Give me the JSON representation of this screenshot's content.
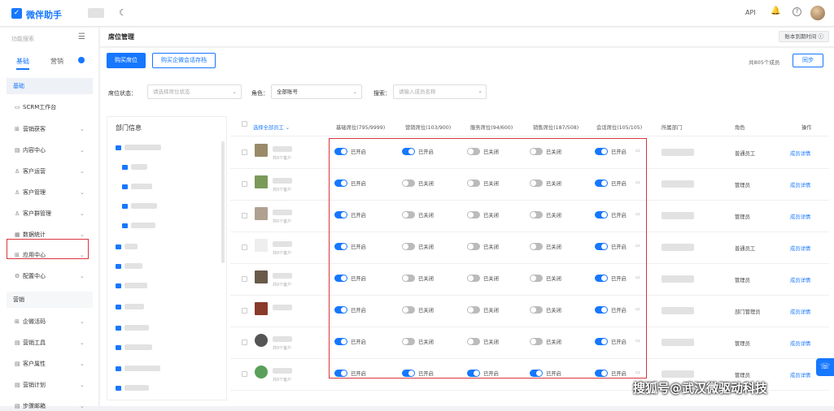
{
  "topbar": {
    "app_name": "微伴助手",
    "logo_glyph": "✓",
    "api_label": "API",
    "bell_icon": "🔔",
    "help_label": "?"
  },
  "sidebar": {
    "search_placeholder": "功能搜索",
    "tab_basic": "基础",
    "tab_marketing": "营销",
    "section_basic": "基础",
    "section_marketing": "营销",
    "items": [
      {
        "icon": "▭",
        "label": "SCRM工作台",
        "chev": false
      },
      {
        "icon": "⊞",
        "label": "营销获客",
        "chev": true
      },
      {
        "icon": "▤",
        "label": "内容中心",
        "chev": true
      },
      {
        "icon": "♙",
        "label": "客户运营",
        "chev": true
      },
      {
        "icon": "♙",
        "label": "客户管理",
        "chev": true
      },
      {
        "icon": "♙",
        "label": "客户群管理",
        "chev": true
      },
      {
        "icon": "▦",
        "label": "数据统计",
        "chev": true
      },
      {
        "icon": "⊞",
        "label": "应用中心",
        "chev": true
      },
      {
        "icon": "⚙",
        "label": "配置中心",
        "chev": true
      }
    ],
    "marketing_items": [
      {
        "icon": "⊞",
        "label": "企微活码",
        "chev": true
      },
      {
        "icon": "▤",
        "label": "营销工具",
        "chev": true
      },
      {
        "icon": "▤",
        "label": "客户属性",
        "chev": true
      },
      {
        "icon": "▤",
        "label": "营销计划",
        "chev": true
      },
      {
        "icon": "▤",
        "label": "步骤邮箱",
        "chev": true
      }
    ]
  },
  "header": {
    "title": "席位管理",
    "expire_label": "账本到期时间 ⓘ"
  },
  "toolbar": {
    "buy_label": "购买席位",
    "buy_storage_label": "购买企微会话存档",
    "member_count": "共805个成员",
    "sync_label": "同步"
  },
  "filters": {
    "status_label": "席位状态：",
    "status_placeholder": "请选择席位状态",
    "role_label": "角色：",
    "role_value": "全部账号",
    "search_label": "搜索：",
    "search_placeholder": "请输入成员名称"
  },
  "dept": {
    "title": "部门信息"
  },
  "table": {
    "select_all": "选择全部员工 ⌄",
    "headers": {
      "basic": "基础席位(795/9999)",
      "marketing": "营销席位(103/900)",
      "service": "服务席位(94/600)",
      "sales": "销售席位(187/508)",
      "session": "会话席位(105/105)",
      "department": "所属部门",
      "role": "角色",
      "action": "操作"
    },
    "on_text": "已开启",
    "off_text": "已关闭",
    "detail_text": "成员详情",
    "rows": [
      {
        "sub": "共0个客户",
        "role": "普通员工",
        "basic": true,
        "marketing": true,
        "service": false,
        "sales": false,
        "session": true
      },
      {
        "sub": "共0个客户",
        "role": "管理员",
        "basic": true,
        "marketing": false,
        "service": false,
        "sales": false,
        "session": true
      },
      {
        "sub": "共0个客户",
        "role": "管理员",
        "basic": true,
        "marketing": false,
        "service": false,
        "sales": false,
        "session": true
      },
      {
        "sub": "共0个客户",
        "role": "普通员工",
        "basic": true,
        "marketing": false,
        "service": false,
        "sales": false,
        "session": true
      },
      {
        "sub": "共0个客户",
        "role": "管理员",
        "basic": true,
        "marketing": false,
        "service": false,
        "sales": false,
        "session": true
      },
      {
        "sub": "",
        "role": "部门管理员",
        "basic": true,
        "marketing": false,
        "service": false,
        "sales": false,
        "session": true
      },
      {
        "sub": "共0个客户",
        "role": "管理员",
        "basic": true,
        "marketing": false,
        "service": false,
        "sales": false,
        "session": true
      },
      {
        "sub": "共0个客户",
        "role": "管理员",
        "basic": true,
        "marketing": true,
        "service": true,
        "sales": true,
        "session": true
      }
    ]
  },
  "watermark": "搜狐号@武汉微驱动科技",
  "colors": {
    "accent": "#1677ff",
    "highlight": "#d9363e"
  }
}
